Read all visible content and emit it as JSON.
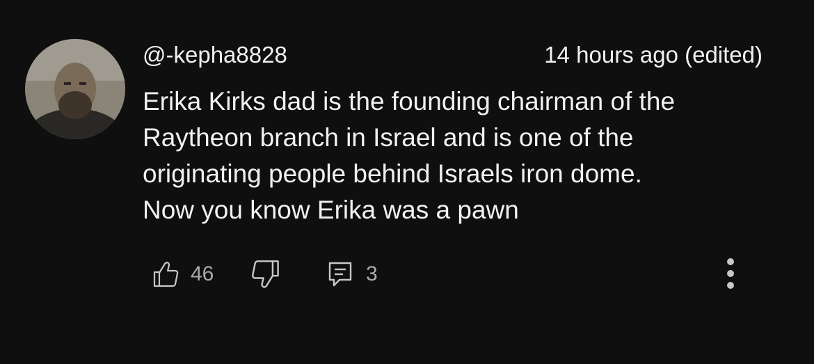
{
  "comment": {
    "author_handle": "@-kepha8828",
    "timestamp": "14 hours ago (edited)",
    "text_lines": [
      "Erika Kirks dad is the founding chairman of the",
      "Raytheon branch in Israel and is one of the",
      "originating people behind Israels iron dome.",
      "Now you know Erika was a pawn"
    ],
    "like_count": "46",
    "reply_count": "3"
  },
  "icons": {
    "like": "thumbs-up-icon",
    "dislike": "thumbs-down-icon",
    "reply": "comment-icon",
    "more": "more-vertical-icon"
  },
  "colors": {
    "background": "#0f0f0f",
    "text": "#f1f1f1",
    "secondary_text": "#aaaaaa",
    "icon": "#c8c8c8"
  }
}
